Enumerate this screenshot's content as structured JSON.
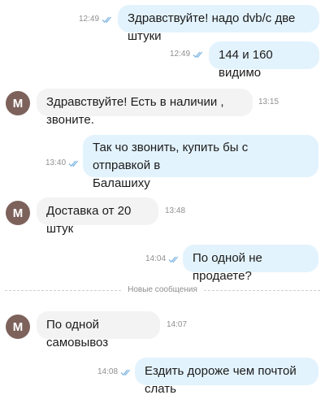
{
  "messages": [
    {
      "direction": "out",
      "text": "Здравствуйте! надо dvb/c две штуки",
      "time": "12:49",
      "read": true
    },
    {
      "direction": "out",
      "text": "144 и 160 видимо",
      "time": "12:49",
      "read": true
    },
    {
      "direction": "in",
      "text": "Здравствуйте! Есть в наличии , звоните.",
      "time": "13:15",
      "avatar": "M"
    },
    {
      "direction": "out",
      "text": "Так чо звонить, купить бы с отправкой в\nБалашиху",
      "time": "13:40",
      "read": true
    },
    {
      "direction": "in",
      "text": "Доставка от 20 штук",
      "time": "13:48",
      "avatar": "M"
    },
    {
      "direction": "out",
      "text": "По одной не продаете?",
      "time": "14:04",
      "read": true
    },
    {
      "direction": "in",
      "text": "По одной самовывоз",
      "time": "14:07",
      "avatar": "M"
    },
    {
      "direction": "out",
      "text": "Ездить дороже чем почтой слать",
      "time": "14:08",
      "read": true
    }
  ],
  "divider": {
    "label": "Новые сообщения"
  },
  "colors": {
    "outgoing_bubble": "#e3f3fd",
    "incoming_bubble": "#f3f3f3",
    "read_ticks": "#7fb6e3",
    "avatar_bg": "#7d625c",
    "meta_text": "#8f8f8f"
  }
}
